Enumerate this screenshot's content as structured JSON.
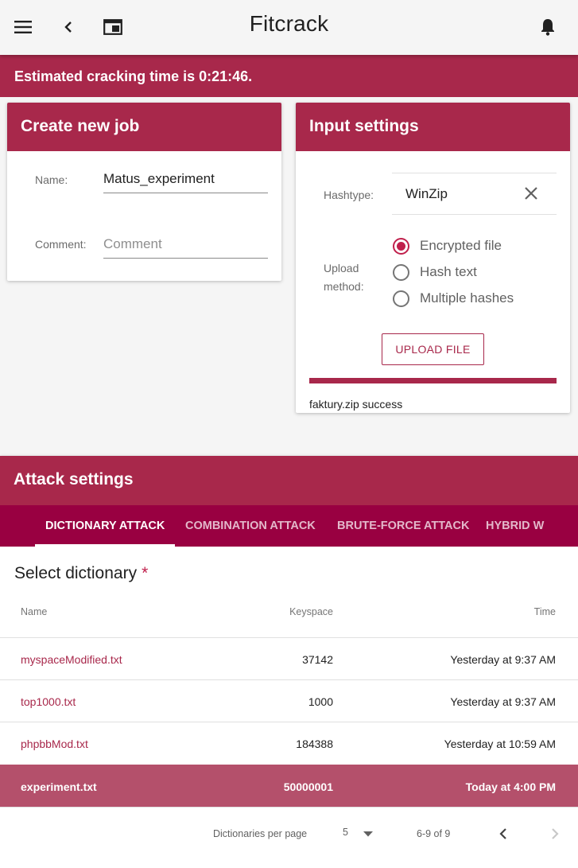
{
  "app": {
    "title": "Fitcrack",
    "icons": [
      "menu-icon",
      "back-icon",
      "window-icon",
      "notifications-icon"
    ]
  },
  "banner": {
    "text": "Estimated cracking time is 0:21:46."
  },
  "create_job": {
    "title": "Create new job",
    "name_label": "Name:",
    "name_value": "Matus_experiment",
    "comment_label": "Comment:",
    "comment_placeholder": "Comment"
  },
  "input_settings": {
    "title": "Input settings",
    "hashtype_label": "Hashtype:",
    "hashtype_value": "WinZip",
    "upload_method_label_1": "Upload",
    "upload_method_label_2": "method:",
    "upload_methods": [
      {
        "label": "Encrypted file",
        "checked": true
      },
      {
        "label": "Hash text",
        "checked": false
      },
      {
        "label": "Multiple hashes",
        "checked": false
      }
    ],
    "upload_button": "UPLOAD FILE",
    "upload_progress": 1.0,
    "upload_status": "faktury.zip success"
  },
  "attack_settings": {
    "title": "Attack settings",
    "tabs": [
      {
        "label": "DICTIONARY ATTACK",
        "active": true
      },
      {
        "label": "COMBINATION ATTACK",
        "active": false
      },
      {
        "label": "BRUTE-FORCE ATTACK",
        "active": false
      },
      {
        "label": "HYBRID W",
        "active": false
      }
    ],
    "section_title": "Select dictionary",
    "required_mark": "*",
    "columns": {
      "name": "Name",
      "keyspace": "Keyspace",
      "time": "Time"
    },
    "rows": [
      {
        "name": "myspaceModified.txt",
        "keyspace": "37142",
        "time": "Yesterday at 9:37 AM",
        "selected": false
      },
      {
        "name": "top1000.txt",
        "keyspace": "1000",
        "time": "Yesterday at 9:37 AM",
        "selected": false
      },
      {
        "name": "phpbbMod.txt",
        "keyspace": "184388",
        "time": "Yesterday at 10:59 AM",
        "selected": false
      },
      {
        "name": "experiment.txt",
        "keyspace": "50000001",
        "time": "Today at 4:00 PM",
        "selected": true
      }
    ],
    "pagination": {
      "per_page_label": "Dictionaries per page",
      "per_page_value": "5",
      "range": "6-9 of 9"
    }
  },
  "colors": {
    "accent": "#a8284b",
    "tab_bar": "#990041",
    "selected_row": "#b4506b",
    "radio_checked": "#c0204c"
  }
}
